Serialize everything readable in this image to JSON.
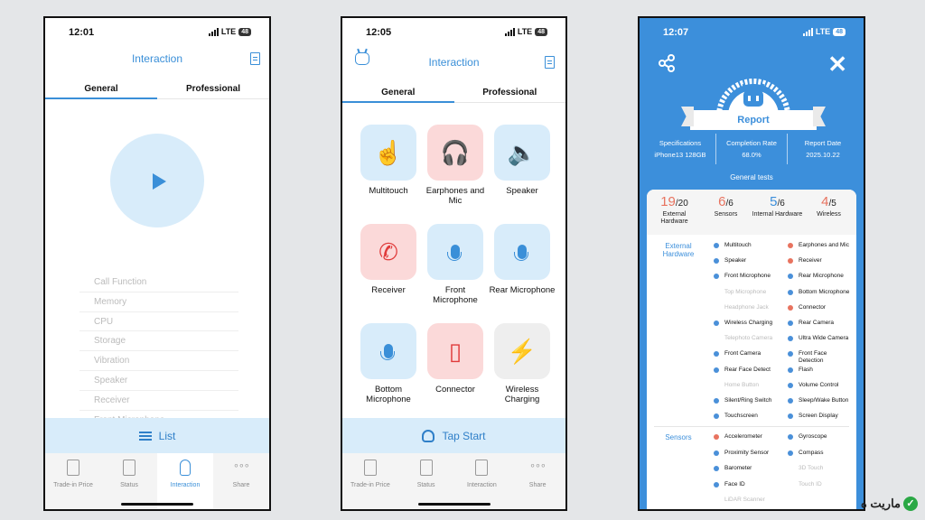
{
  "status": {
    "time1": "12:01",
    "time2": "12:05",
    "time3": "12:07",
    "network": "LTE",
    "battery": "48"
  },
  "nav": {
    "title": "Interaction"
  },
  "tabs": {
    "general": "General",
    "professional": "Professional"
  },
  "screen1": {
    "functions": [
      "Call Function",
      "Memory",
      "CPU",
      "Storage",
      "Vibration",
      "Speaker",
      "Receiver",
      "Front Microphone"
    ],
    "list_label": "List"
  },
  "screen2": {
    "tests": [
      {
        "label": "Multitouch",
        "color": "blue",
        "icon": "touch-icon"
      },
      {
        "label": "Earphones and Mic",
        "color": "red",
        "icon": "headset-icon"
      },
      {
        "label": "Speaker",
        "color": "blue",
        "icon": "speaker-icon"
      },
      {
        "label": "Receiver",
        "color": "red",
        "icon": "phone-icon"
      },
      {
        "label": "Front Microphone",
        "color": "blue",
        "icon": "microphone-icon"
      },
      {
        "label": "Rear Microphone",
        "color": "blue",
        "icon": "microphone-icon"
      },
      {
        "label": "Bottom Microphone",
        "color": "blue",
        "icon": "microphone-icon"
      },
      {
        "label": "Connector",
        "color": "red",
        "icon": "connector-icon"
      },
      {
        "label": "Wireless Charging",
        "color": "grey",
        "icon": "wireless-charging-icon"
      }
    ],
    "tap_label": "Tap Start"
  },
  "tabbar": {
    "items": [
      "Trade-in Price",
      "Status",
      "Interaction",
      "Share"
    ]
  },
  "report": {
    "title": "Report",
    "spec_label": "Specifications",
    "spec_value": "iPhone13 128GB",
    "rate_label": "Completion Rate",
    "rate_value": "68.0%",
    "date_label": "Report Date",
    "date_value": "2025.10.22",
    "general_tests": "General tests",
    "scores": [
      {
        "got": "19",
        "total": "/20",
        "label": "External Hardware",
        "color": "#e8735f"
      },
      {
        "got": "6",
        "total": "/6",
        "label": "Sensors",
        "color": "#e8735f"
      },
      {
        "got": "5",
        "total": "/6",
        "label": "Internal Hardware",
        "color": "#3c8fdb"
      },
      {
        "got": "4",
        "total": "/5",
        "label": "Wireless",
        "color": "#e8735f"
      }
    ],
    "external_label": "External Hardware",
    "external_items": [
      {
        "name": "Multitouch",
        "state": "blue"
      },
      {
        "name": "Earphones and Mic",
        "state": "red"
      },
      {
        "name": "Speaker",
        "state": "blue"
      },
      {
        "name": "Receiver",
        "state": "red"
      },
      {
        "name": "Front Microphone",
        "state": "blue"
      },
      {
        "name": "Rear Microphone",
        "state": "blue"
      },
      {
        "name": "Top Microphone",
        "state": "off"
      },
      {
        "name": "Bottom Microphone",
        "state": "blue"
      },
      {
        "name": "Headphone Jack",
        "state": "off"
      },
      {
        "name": "Connector",
        "state": "red"
      },
      {
        "name": "Wireless Charging",
        "state": "blue"
      },
      {
        "name": "Rear Camera",
        "state": "blue"
      },
      {
        "name": "Telephoto Camera",
        "state": "off"
      },
      {
        "name": "Ultra Wide Camera",
        "state": "blue"
      },
      {
        "name": "Front Camera",
        "state": "blue"
      },
      {
        "name": "Front Face Detection",
        "state": "blue"
      },
      {
        "name": "Rear Face Detect",
        "state": "blue"
      },
      {
        "name": "Flash",
        "state": "blue"
      },
      {
        "name": "Home Button",
        "state": "off"
      },
      {
        "name": "Volume Control",
        "state": "blue"
      },
      {
        "name": "Silent/Ring Switch",
        "state": "blue"
      },
      {
        "name": "Sleep/Wake Button",
        "state": "blue"
      },
      {
        "name": "Touchscreen",
        "state": "blue"
      },
      {
        "name": "Screen Display",
        "state": "blue"
      }
    ],
    "sensors_label": "Sensors",
    "sensor_items": [
      {
        "name": "Accelerometer",
        "state": "red"
      },
      {
        "name": "Gyroscope",
        "state": "blue"
      },
      {
        "name": "Proximity Sensor",
        "state": "blue"
      },
      {
        "name": "Compass",
        "state": "blue"
      },
      {
        "name": "Barometer",
        "state": "blue"
      },
      {
        "name": "3D Touch",
        "state": "off"
      },
      {
        "name": "Face ID",
        "state": "blue"
      },
      {
        "name": "Touch ID",
        "state": "off"
      },
      {
        "name": "LiDAR Scanner",
        "state": "off"
      }
    ]
  },
  "watermark": "ماریت ه"
}
